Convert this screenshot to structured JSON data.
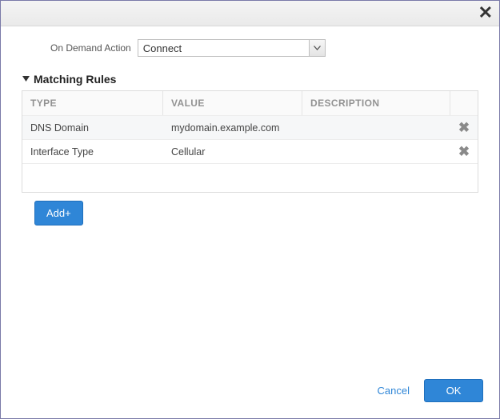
{
  "form": {
    "onDemandAction": {
      "label": "On Demand Action",
      "value": "Connect"
    }
  },
  "section": {
    "matchingRules": {
      "title": "Matching Rules",
      "columns": {
        "type": "TYPE",
        "value": "VALUE",
        "description": "DESCRIPTION"
      },
      "rows": [
        {
          "type": "DNS Domain",
          "value": "mydomain.example.com",
          "description": ""
        },
        {
          "type": "Interface Type",
          "value": "Cellular",
          "description": ""
        }
      ]
    }
  },
  "buttons": {
    "add": "Add+",
    "cancel": "Cancel",
    "ok": "OK"
  },
  "icons": {
    "delete_glyph": "✖"
  }
}
